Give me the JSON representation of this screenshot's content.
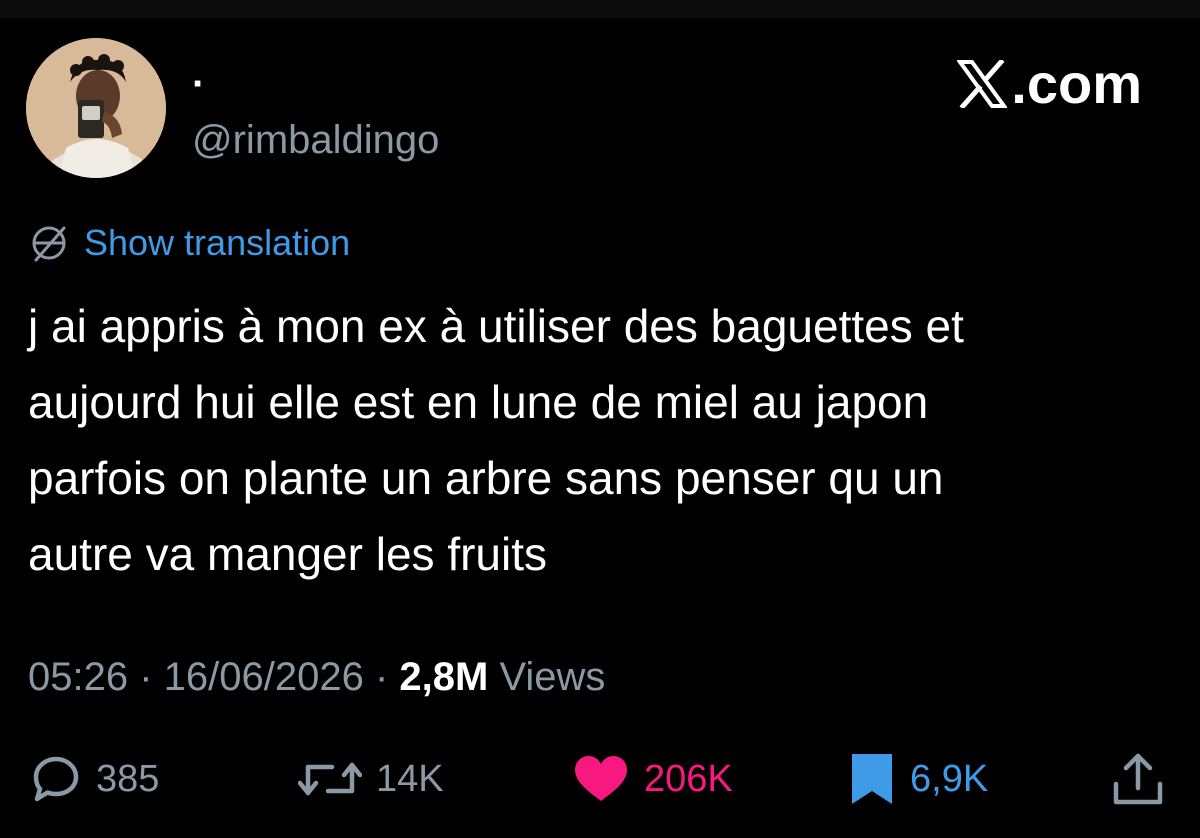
{
  "author": {
    "display_name": "·",
    "handle": "@rimbaldingo"
  },
  "brand": {
    "label": ".com",
    "icon": "x-logo-icon"
  },
  "translation": {
    "label": "Show translation",
    "icon": "globe-icon"
  },
  "tweet": {
    "text": "j ai appris à mon ex à utiliser des baguettes et\naujourd hui elle est en lune de miel au japon\nparfois on plante un arbre sans penser qu un\nautre va manger les fruits"
  },
  "meta": {
    "time": "05:26",
    "separator": " · ",
    "date": "16/06/2026",
    "views_count": "2,8M",
    "views_label": " Views"
  },
  "actions": {
    "reply": {
      "count": "385",
      "icon": "reply-icon"
    },
    "repost": {
      "count": "14K",
      "icon": "repost-icon"
    },
    "like": {
      "count": "206K",
      "icon": "heart-icon",
      "color": "#f91880"
    },
    "bookmark": {
      "count": "6,9K",
      "icon": "bookmark-icon",
      "color": "#3f9ae8"
    },
    "share": {
      "icon": "share-icon"
    }
  },
  "colors": {
    "background": "#000000",
    "text": "#ffffff",
    "muted": "#8b98a5",
    "link": "#3f9ae8",
    "like": "#f91880"
  }
}
